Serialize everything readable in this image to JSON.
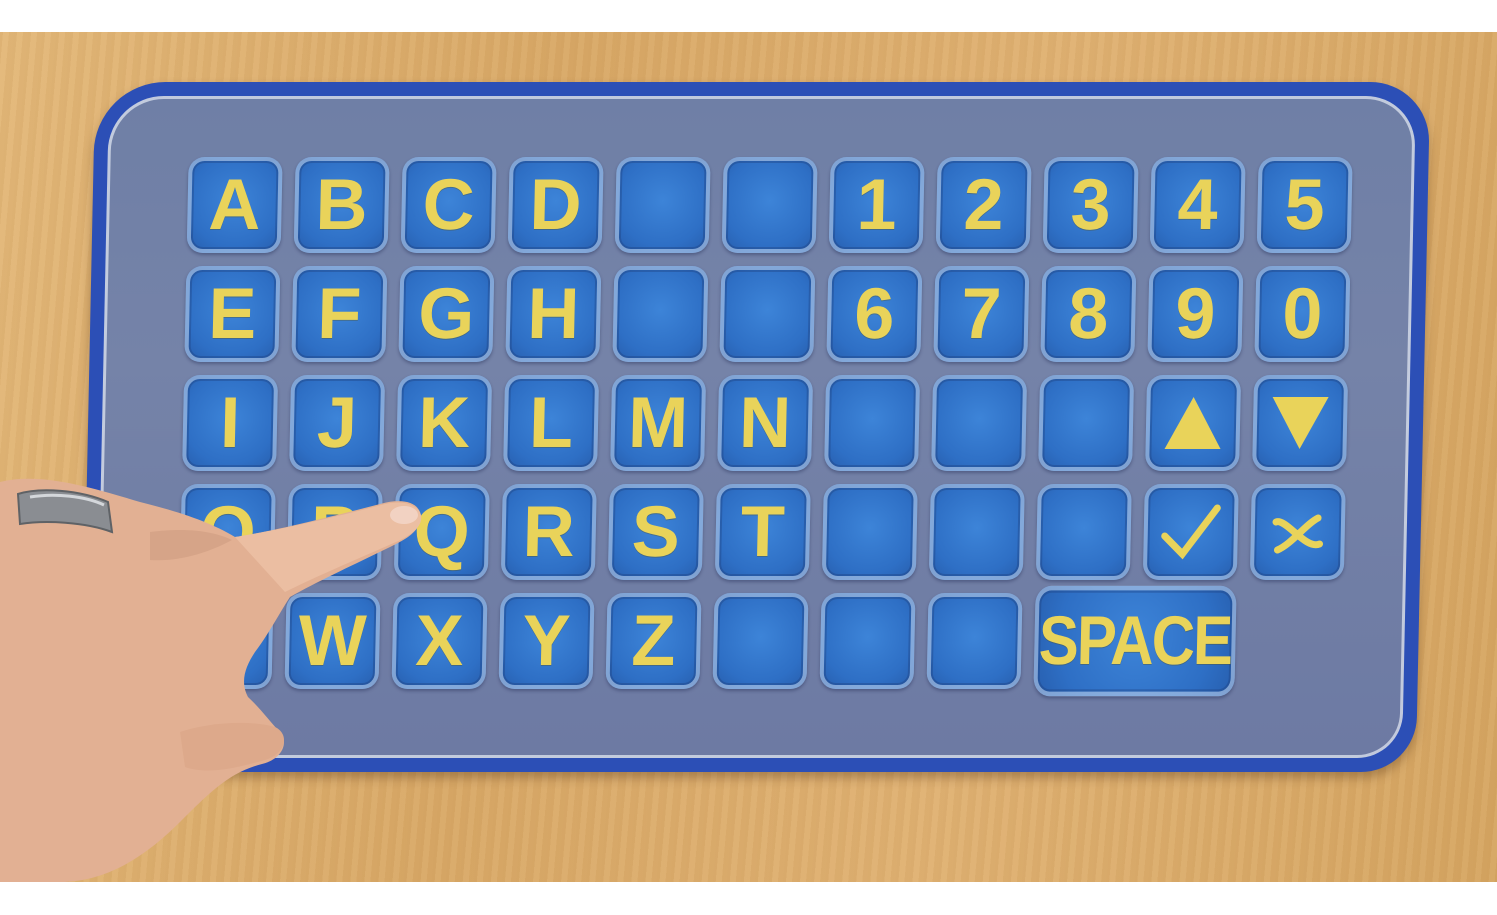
{
  "keyboard": {
    "rows": [
      [
        {
          "label": "A",
          "type": "letter"
        },
        {
          "label": "B",
          "type": "letter"
        },
        {
          "label": "C",
          "type": "letter"
        },
        {
          "label": "D",
          "type": "letter"
        },
        {
          "label": "",
          "type": "blank"
        },
        {
          "label": "",
          "type": "blank"
        },
        {
          "label": "1",
          "type": "digit"
        },
        {
          "label": "2",
          "type": "digit"
        },
        {
          "label": "3",
          "type": "digit"
        },
        {
          "label": "4",
          "type": "digit"
        },
        {
          "label": "5",
          "type": "digit"
        }
      ],
      [
        {
          "label": "E",
          "type": "letter"
        },
        {
          "label": "F",
          "type": "letter"
        },
        {
          "label": "G",
          "type": "letter"
        },
        {
          "label": "H",
          "type": "letter"
        },
        {
          "label": "",
          "type": "blank"
        },
        {
          "label": "",
          "type": "blank"
        },
        {
          "label": "6",
          "type": "digit"
        },
        {
          "label": "7",
          "type": "digit"
        },
        {
          "label": "8",
          "type": "digit"
        },
        {
          "label": "9",
          "type": "digit"
        },
        {
          "label": "0",
          "type": "digit"
        }
      ],
      [
        {
          "label": "I",
          "type": "letter"
        },
        {
          "label": "J",
          "type": "letter"
        },
        {
          "label": "K",
          "type": "letter"
        },
        {
          "label": "L",
          "type": "letter"
        },
        {
          "label": "M",
          "type": "letter"
        },
        {
          "label": "N",
          "type": "letter"
        },
        {
          "label": "",
          "type": "blank"
        },
        {
          "label": "",
          "type": "blank"
        },
        {
          "label": "",
          "type": "blank"
        },
        {
          "label": "",
          "type": "icon",
          "icon": "up-triangle-icon"
        },
        {
          "label": "",
          "type": "icon",
          "icon": "down-triangle-icon"
        }
      ],
      [
        {
          "label": "O",
          "type": "letter"
        },
        {
          "label": "P",
          "type": "letter"
        },
        {
          "label": "Q",
          "type": "letter"
        },
        {
          "label": "R",
          "type": "letter"
        },
        {
          "label": "S",
          "type": "letter"
        },
        {
          "label": "T",
          "type": "letter"
        },
        {
          "label": "",
          "type": "blank"
        },
        {
          "label": "",
          "type": "blank"
        },
        {
          "label": "",
          "type": "blank"
        },
        {
          "label": "",
          "type": "icon",
          "icon": "check-icon"
        },
        {
          "label": "",
          "type": "icon",
          "icon": "cross-icon"
        }
      ],
      [
        {
          "label": "",
          "type": "letter-hidden"
        },
        {
          "label": "W",
          "type": "letter"
        },
        {
          "label": "X",
          "type": "letter"
        },
        {
          "label": "Y",
          "type": "letter"
        },
        {
          "label": "Z",
          "type": "letter"
        },
        {
          "label": "",
          "type": "blank"
        },
        {
          "label": "",
          "type": "blank"
        },
        {
          "label": "",
          "type": "blank"
        },
        {
          "label": "SPACE",
          "type": "space"
        }
      ]
    ]
  },
  "colors": {
    "board_border": "#2c4fb6",
    "board_surface": "#7583a8",
    "key_face": "#2e6fc5",
    "key_legend": "#e9d35a",
    "table": "#dcae6c",
    "skin": "#e6b497"
  }
}
